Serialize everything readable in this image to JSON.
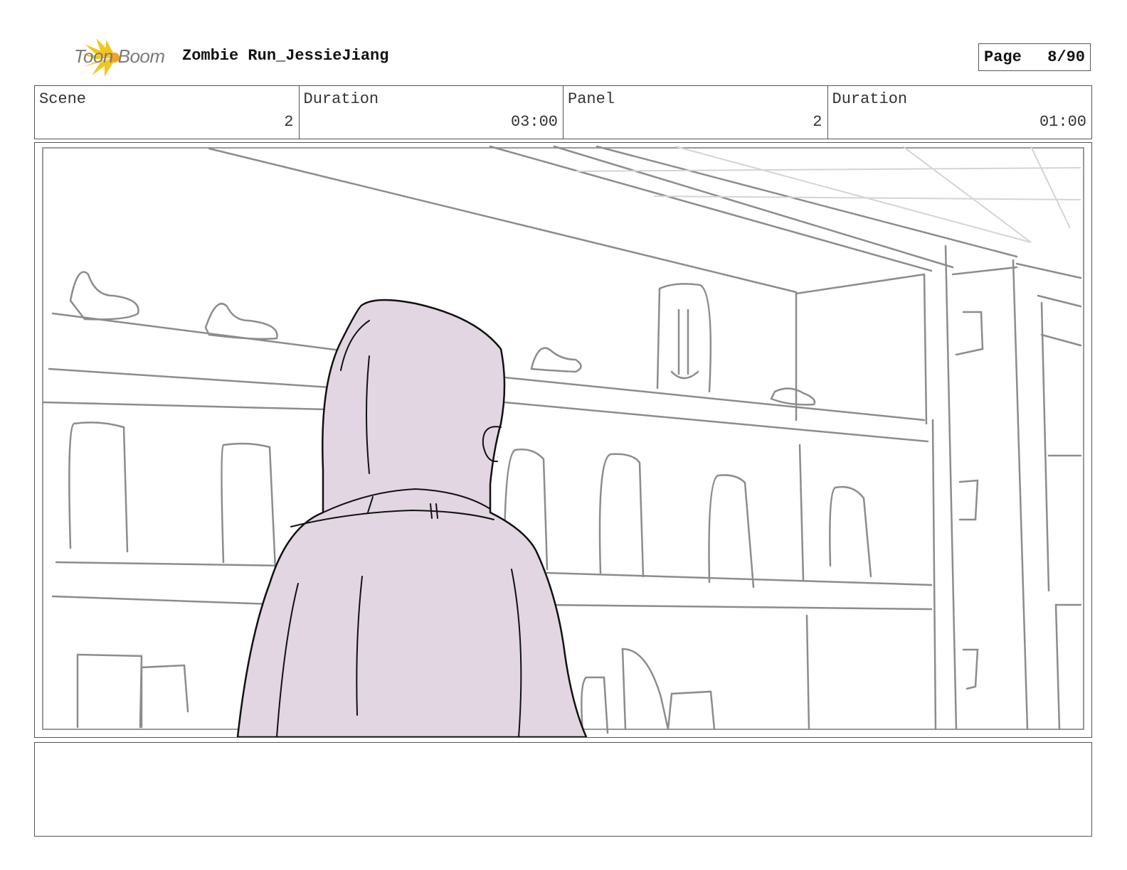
{
  "header": {
    "brand": "Toon Boom",
    "project_title": "Zombie Run_JessieJiang",
    "page_label": "Page",
    "page_value": "8/90"
  },
  "info": {
    "scene_label": "Scene",
    "scene_value": "2",
    "scene_duration_label": "Duration",
    "scene_duration_value": "03:00",
    "panel_label": "Panel",
    "panel_value": "2",
    "panel_duration_label": "Duration",
    "panel_duration_value": "01:00"
  },
  "notes": {
    "text": ""
  },
  "colors": {
    "logo_yellow": "#f5c518",
    "hood_fill": "#e2d6e2",
    "sketch_gray": "#8c8c8c",
    "ink": "#111111"
  }
}
